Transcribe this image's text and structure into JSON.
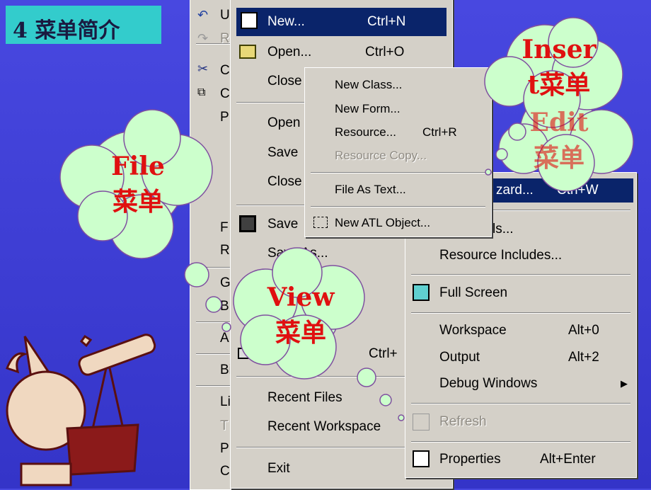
{
  "slide_title": "4 菜单简介",
  "edit_menu": {
    "letters": [
      "U",
      "R",
      "C",
      "C",
      "P",
      "F",
      "R",
      "G",
      "B",
      "A",
      "Bi",
      "Li",
      "T",
      "P",
      "C"
    ]
  },
  "file_menu": {
    "items": [
      {
        "label": "New...",
        "shortcut": "Ctrl+N",
        "highlighted": true
      },
      {
        "label": "Open...",
        "shortcut": "Ctrl+O"
      },
      {
        "label": "Close"
      },
      {
        "label": "Open"
      },
      {
        "label": "Save"
      },
      {
        "label": "Close"
      },
      {
        "label": "Save"
      },
      {
        "label": "Save As..."
      },
      {
        "label": "",
        "shortcut": "Ctrl+"
      },
      {
        "label": "Recent Files"
      },
      {
        "label": "Recent Workspace"
      },
      {
        "label": "Exit"
      }
    ]
  },
  "new_submenu": {
    "items": [
      {
        "label": "New Class..."
      },
      {
        "label": "New Form..."
      },
      {
        "label": "Resource...",
        "shortcut": "Ctrl+R"
      },
      {
        "label": "Resource Copy...",
        "disabled": true
      },
      {
        "label": "File As Text..."
      },
      {
        "label": "New ATL Object..."
      }
    ]
  },
  "view_menu": {
    "items": [
      {
        "label": "zard...",
        "shortcut": "Ctrl+W",
        "highlighted": true
      },
      {
        "label": "e Symbols..."
      },
      {
        "label": "Resource Includes..."
      },
      {
        "label": "Full Screen"
      },
      {
        "label": "Workspace",
        "shortcut": "Alt+0"
      },
      {
        "label": "Output",
        "shortcut": "Alt+2"
      },
      {
        "label": "Debug Windows",
        "arrow": "▶"
      },
      {
        "label": "Refresh",
        "disabled": true
      },
      {
        "label": "Properties",
        "shortcut": "Alt+Enter"
      }
    ]
  },
  "callouts": {
    "file": [
      "File",
      "菜单"
    ],
    "insert": [
      "Inser",
      "t菜单"
    ],
    "edit": [
      "Edit",
      "菜单"
    ],
    "view": [
      "View",
      "菜单"
    ]
  },
  "colors": {
    "background": "#3c3cd4",
    "title_bg": "#33cccc",
    "cloud": "#ccffcc",
    "callout_text": "#e01010",
    "highlight": "#0a246a",
    "menu_bg": "#d4d0c8"
  }
}
